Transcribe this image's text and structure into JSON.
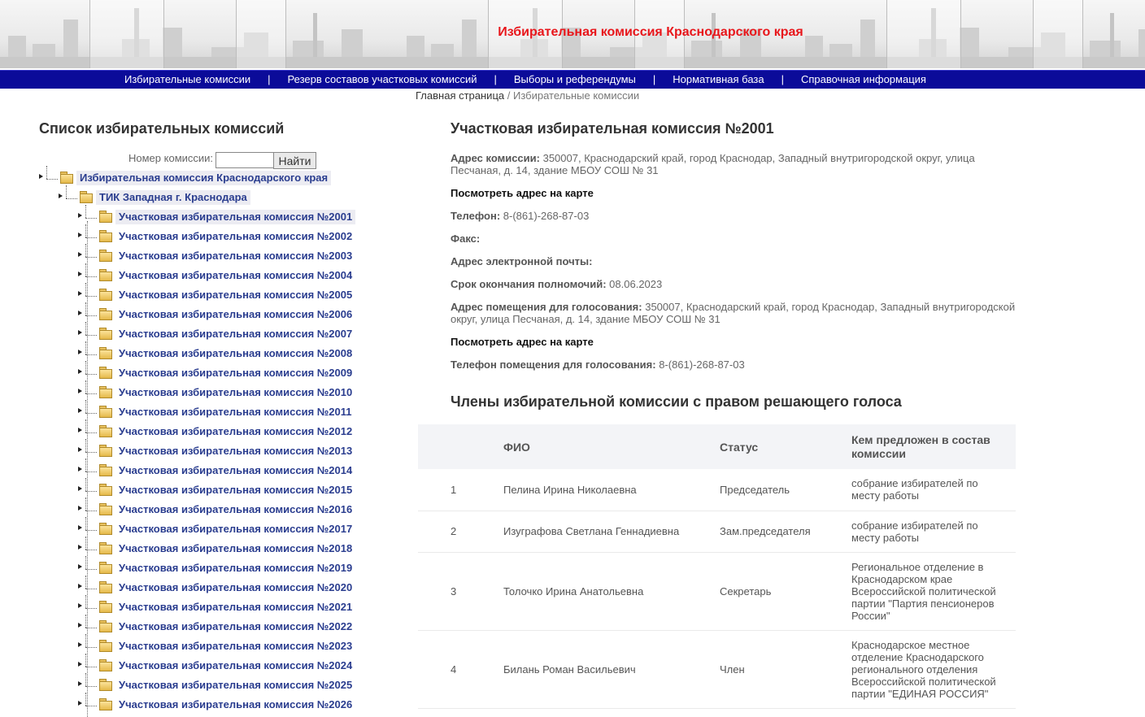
{
  "header": {
    "title": "Избирательная комиссия Краснодарского края"
  },
  "nav": {
    "items": [
      "Избирательные комиссии",
      "Резерв составов участковых комиссий",
      "Выборы и референдумы",
      "Нормативная база",
      "Справочная информация"
    ],
    "separator": "|"
  },
  "breadcrumb": {
    "home": "Главная страница",
    "separator": " / ",
    "current": "Избирательные комиссии"
  },
  "left": {
    "title": "Список избирательных комиссий",
    "search_label": "Номер комиссии:",
    "search_value": "",
    "search_button": "Найти",
    "tree": {
      "root": "Избирательная комиссия Краснодарского края",
      "tik": "ТИК Западная г. Краснодара",
      "selected": "Участковая избирательная комиссия №2001",
      "uiks": [
        "Участковая избирательная комиссия №2001",
        "Участковая избирательная комиссия №2002",
        "Участковая избирательная комиссия №2003",
        "Участковая избирательная комиссия №2004",
        "Участковая избирательная комиссия №2005",
        "Участковая избирательная комиссия №2006",
        "Участковая избирательная комиссия №2007",
        "Участковая избирательная комиссия №2008",
        "Участковая избирательная комиссия №2009",
        "Участковая избирательная комиссия №2010",
        "Участковая избирательная комиссия №2011",
        "Участковая избирательная комиссия №2012",
        "Участковая избирательная комиссия №2013",
        "Участковая избирательная комиссия №2014",
        "Участковая избирательная комиссия №2015",
        "Участковая избирательная комиссия №2016",
        "Участковая избирательная комиссия №2017",
        "Участковая избирательная комиссия №2018",
        "Участковая избирательная комиссия №2019",
        "Участковая избирательная комиссия №2020",
        "Участковая избирательная комиссия №2021",
        "Участковая избирательная комиссия №2022",
        "Участковая избирательная комиссия №2023",
        "Участковая избирательная комиссия №2024",
        "Участковая избирательная комиссия №2025",
        "Участковая избирательная комиссия №2026"
      ]
    }
  },
  "commission": {
    "title": "Участковая избирательная комиссия №2001",
    "address_label": "Адрес комиссии:",
    "address_value": "350007, Краснодарский край, город Краснодар, Западный внутригородской округ, улица Песчаная, д. 14, здание МБОУ СОШ № 31",
    "map_link": "Посмотреть адрес на карте",
    "phone_label": "Телефон:",
    "phone_value": "8-(861)-268-87-03",
    "fax_label": "Факс:",
    "fax_value": "",
    "email_label": "Адрес электронной почты:",
    "email_value": "",
    "term_label": "Срок окончания полномочий:",
    "term_value": "08.06.2023",
    "voting_address_label": "Адрес помещения для голосования:",
    "voting_address_value": "350007, Краснодарский край, город Краснодар, Западный внутригородской округ, улица Песчаная, д. 14, здание МБОУ СОШ № 31",
    "map_link2": "Посмотреть адрес на карте",
    "voting_phone_label": "Телефон помещения для голосования:",
    "voting_phone_value": "8-(861)-268-87-03"
  },
  "members": {
    "title": "Члены избирательной комиссии с правом решающего голоса",
    "headers": {
      "num": "",
      "name": "ФИО",
      "status": "Статус",
      "proposed": "Кем предложен в состав комиссии"
    },
    "rows": [
      {
        "num": "1",
        "name": "Пелина Ирина Николаевна",
        "status": "Председатель",
        "proposed": "собрание избирателей по месту работы"
      },
      {
        "num": "2",
        "name": "Изуграфова Светлана Геннадиевна",
        "status": "Зам.председателя",
        "proposed": "собрание избирателей по месту работы"
      },
      {
        "num": "3",
        "name": "Толочко Ирина Анатольевна",
        "status": "Секретарь",
        "proposed": "Региональное отделение в Краснодарском крае Всероссийской политической партии \"Партия пенсионеров России\""
      },
      {
        "num": "4",
        "name": "Билань Роман Васильевич",
        "status": "Член",
        "proposed": "Краснодарское местное отделение Краснодарского регионального отделения Всероссийской политической партии \"ЕДИНАЯ РОССИЯ\""
      }
    ]
  }
}
